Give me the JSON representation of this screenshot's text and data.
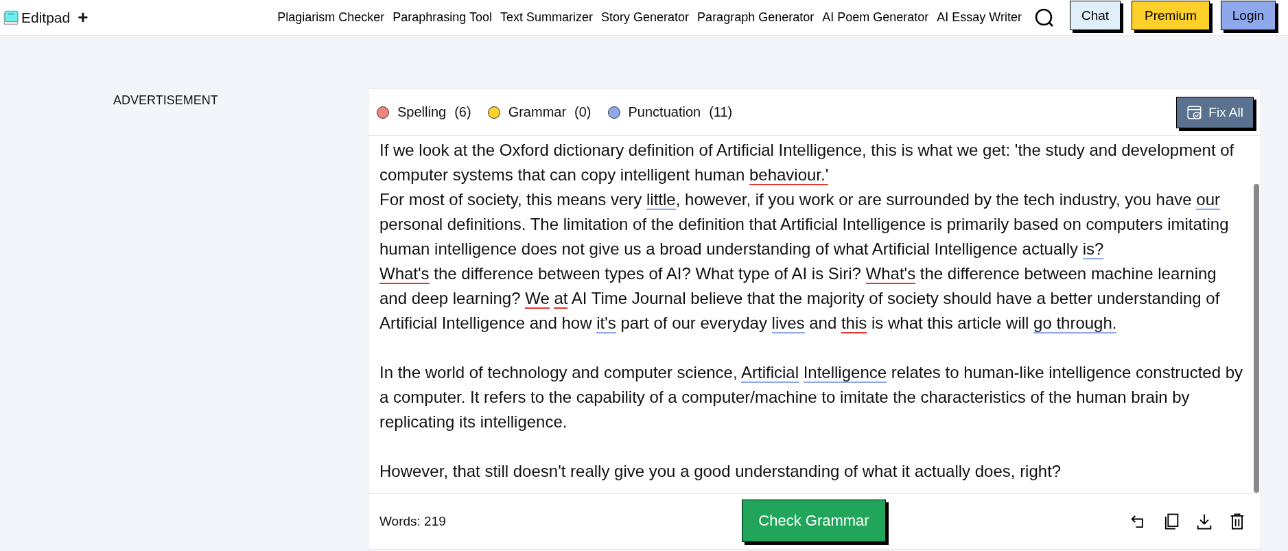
{
  "header": {
    "logo": "Editpad",
    "add": "+",
    "nav": [
      "Plagiarism Checker",
      "Paraphrasing Tool",
      "Text Summarizer",
      "Story Generator",
      "Paragraph Generator",
      "AI Poem Generator",
      "AI Essay Writer"
    ],
    "buttons": [
      {
        "label": "Chat",
        "color": "#e0f0fa"
      },
      {
        "label": "Premium",
        "color": "#fdd02a"
      },
      {
        "label": "Login",
        "color": "#8fa8ec"
      }
    ]
  },
  "sidebar": {
    "ad_label": "ADVERTISEMENT"
  },
  "legend": [
    {
      "label": "Spelling",
      "count": "(6)",
      "color": "#f0857b"
    },
    {
      "label": "Grammar",
      "count": "(0)",
      "color": "#fdd02a"
    },
    {
      "label": "Punctuation",
      "count": "(11)",
      "color": "#8fa8ec"
    }
  ],
  "fix_all": "Fix All",
  "paragraphs": [
    {
      "blank_line_before": false,
      "segments": [
        {
          "text": "If we look at the Oxford dictionary definition of Artificial Intelligence, this is what we get: 'the study and development of computer systems that can copy intelligent human ",
          "kind": "plain"
        },
        {
          "text": "behaviour.'",
          "kind": "spelling"
        }
      ]
    },
    {
      "blank_line_before": false,
      "segments": [
        {
          "text": "For most of society, this means very ",
          "kind": "plain"
        },
        {
          "text": "little",
          "kind": "punctuation"
        },
        {
          "text": ", however, if you work or are surrounded by the tech industry, you have ",
          "kind": "plain"
        },
        {
          "text": "our",
          "kind": "punctuation"
        },
        {
          "text": " personal definitions. The limitation of the definition that Artificial Intelligence is primarily based on computers imitating human intelligence does not give us a broad understanding of what Artificial Intelligence actually ",
          "kind": "plain"
        },
        {
          "text": "is?",
          "kind": "punctuation"
        }
      ]
    },
    {
      "blank_line_before": false,
      "segments": [
        {
          "text": "What's",
          "kind": "spelling"
        },
        {
          "text": " the difference between types of AI? What type of AI is Siri? ",
          "kind": "plain"
        },
        {
          "text": "What's",
          "kind": "spelling"
        },
        {
          "text": " the difference between machine learning and deep learning? ",
          "kind": "plain"
        },
        {
          "text": "We",
          "kind": "spelling"
        },
        {
          "text": " at",
          "kind": "spelling"
        },
        {
          "text": " AI Time Journal believe that the majority of society should have a better understanding of Artificial Intelligence and how ",
          "kind": "plain"
        },
        {
          "text": "it's",
          "kind": "punctuation"
        },
        {
          "text": " part of our everyday ",
          "kind": "plain"
        },
        {
          "text": "lives",
          "kind": "punctuation"
        },
        {
          "text": " and ",
          "kind": "plain"
        },
        {
          "text": "this",
          "kind": "spelling"
        },
        {
          "text": " is what this article will ",
          "kind": "plain"
        },
        {
          "text": "go through.",
          "kind": "punctuation"
        }
      ]
    },
    {
      "blank_line_before": true,
      "segments": [
        {
          "text": "In the world of technology and computer science, ",
          "kind": "plain"
        },
        {
          "text": "Artificial",
          "kind": "punctuation"
        },
        {
          "text": " Intelligence",
          "kind": "punctuation"
        },
        {
          "text": " relates to human-like intelligence constructed by a computer. It refers to the capability of a computer/machine to imitate the characteristics of the human brain by replicating its intelligence.",
          "kind": "plain"
        }
      ]
    },
    {
      "blank_line_before": true,
      "segments": [
        {
          "text": "However, that still doesn't really give you a good understanding of what it actually does, right?",
          "kind": "plain"
        }
      ]
    }
  ],
  "footer": {
    "words": "Words: 219",
    "check_button": "Check Grammar"
  }
}
